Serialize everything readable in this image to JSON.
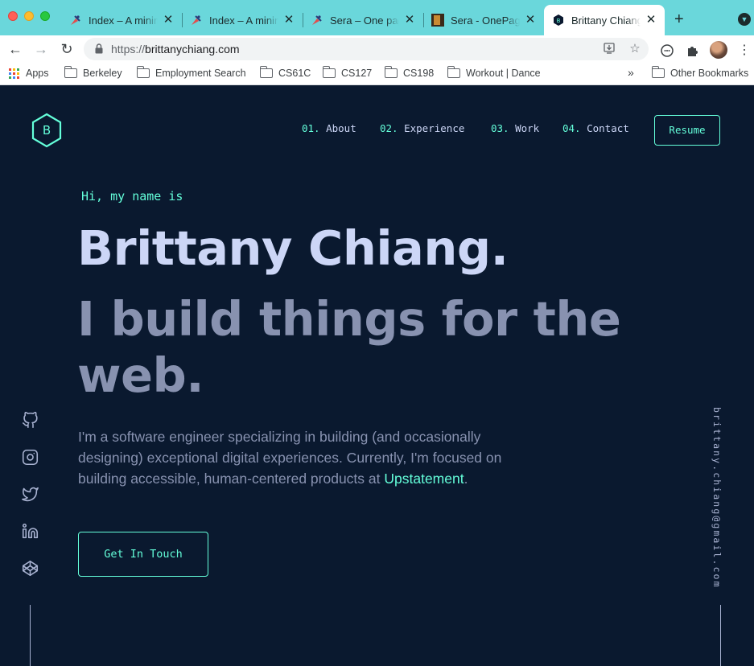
{
  "browser": {
    "tabs": [
      {
        "title": "Index – A minimal",
        "favicon": "pin-icon",
        "active": false
      },
      {
        "title": "Index – A minimal",
        "favicon": "pin-icon",
        "active": false
      },
      {
        "title": "Sera – One page",
        "favicon": "pin-icon",
        "active": false
      },
      {
        "title": "Sera - OnePage",
        "favicon": "image-thumb-icon",
        "active": false
      },
      {
        "title": "Brittany Chiang",
        "favicon": "hexagon-b-icon",
        "active": true
      }
    ],
    "new_tab": "+",
    "close_glyph": "✕",
    "url_scheme": "https://",
    "url_host": "brittanychiang.com",
    "bookmarks": [
      {
        "label": "Apps",
        "icon": "apps-grid-icon"
      },
      {
        "label": "Berkeley",
        "icon": "folder-icon"
      },
      {
        "label": "Employment Search",
        "icon": "folder-icon"
      },
      {
        "label": "CS61C",
        "icon": "folder-icon"
      },
      {
        "label": "CS127",
        "icon": "folder-icon"
      },
      {
        "label": "CS198",
        "icon": "folder-icon"
      },
      {
        "label": "Workout | Dance",
        "icon": "folder-icon"
      }
    ],
    "bookmarks_overflow": "»",
    "other_bookmarks": "Other Bookmarks",
    "colors": {
      "tabbar": "#6ad7db",
      "toolbar": "#ffffff"
    }
  },
  "site": {
    "logo_letter": "B",
    "nav": [
      {
        "num": "01.",
        "label": "About"
      },
      {
        "num": "02.",
        "label": "Experience"
      },
      {
        "num": "03.",
        "label": "Work"
      },
      {
        "num": "04.",
        "label": "Contact"
      }
    ],
    "resume": "Resume",
    "hero": {
      "greeting": "Hi, my name is",
      "name": "Brittany Chiang.",
      "tagline": "I build things for the web.",
      "description_before": "I'm a software engineer specializing in building (and occasionally designing) exceptional digital experiences. Currently, I'm focused on building accessible, human-centered products at ",
      "description_link": "Upstatement",
      "description_after": ".",
      "cta": "Get In Touch"
    },
    "social": [
      "github-icon",
      "instagram-icon",
      "twitter-icon",
      "linkedin-icon",
      "codepen-icon"
    ],
    "email": "brittany.chiang@gmail.com",
    "colors": {
      "background": "#0a192f",
      "accent": "#64ffda",
      "heading": "#ccd6f6",
      "muted": "#8892b0"
    }
  }
}
